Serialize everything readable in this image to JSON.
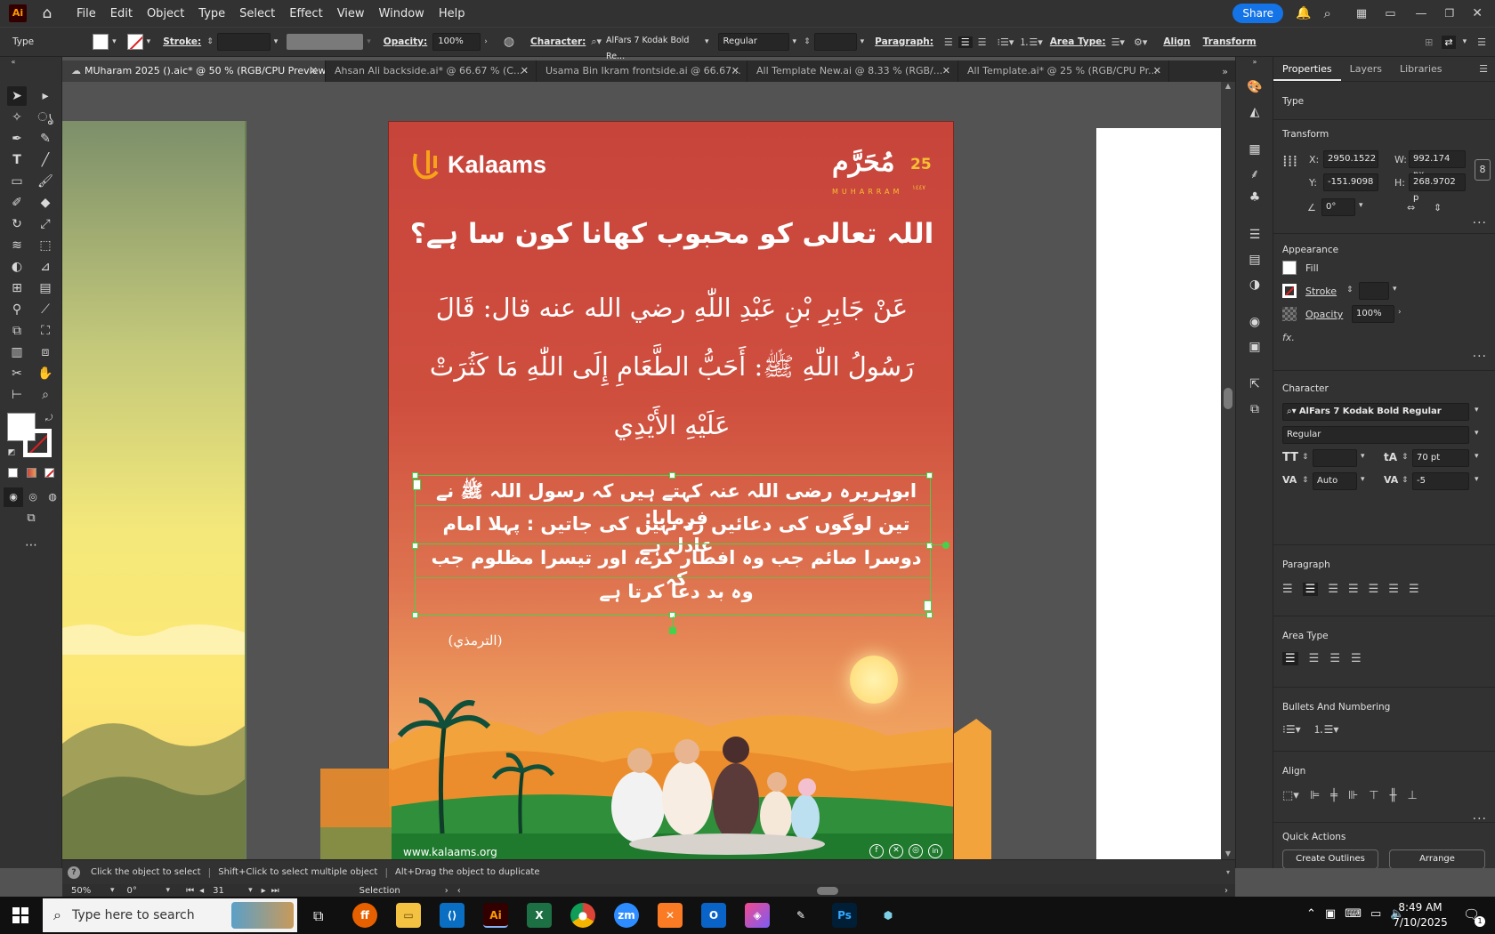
{
  "app": {
    "logo": "Ai",
    "share_label": "Share"
  },
  "menu": [
    "File",
    "Edit",
    "Object",
    "Type",
    "Select",
    "Effect",
    "View",
    "Window",
    "Help"
  ],
  "control": {
    "selection_type": "Type",
    "stroke_label": "Stroke:",
    "opacity_label": "Opacity:",
    "opacity_value": "100%",
    "character_label": "Character:",
    "font_name": "AlFars 7 Kodak Bold Re...",
    "font_style": "Regular",
    "paragraph_label": "Paragraph:",
    "area_type_label": "Area Type:",
    "align_label": "Align",
    "transform_label": "Transform"
  },
  "tabs": [
    {
      "label": "MUharam 2025 ().aic* @ 50 % (RGB/CPU Preview)"
    },
    {
      "label": "Ahsan Ali backside.ai* @ 66.67 % (C..."
    },
    {
      "label": "Usama Bin Ikram frontside.ai @ 66.67..."
    },
    {
      "label": "All Template New.ai @ 8.33 % (RGB/..."
    },
    {
      "label": "All Template.ai* @ 25 % (RGB/CPU Pr..."
    }
  ],
  "artboard": {
    "brand": "Kalaams",
    "muharram_arabic": "مُحَرَّم",
    "muharram_num": "25",
    "muharram_latin": "MUHARRAM",
    "muharram_year": "١٤٤٧",
    "heading": "اللہ تعالی کو محبوب کھانا کون سا ہے؟",
    "arabic_line1": "عَنْ جَابِرِ بْنِ عَبْدِ اللّٰهِ رضي الله عنه قال: قَالَ",
    "arabic_line2": "رَسُولُ اللّٰهِ ﷺ: أَحَبُّ الطَّعَامِ إِلَى اللّٰهِ مَا كَثُرَتْ",
    "arabic_line3": "عَلَيْهِ الأَيْدِي",
    "urdu_line1": "ابوہریرہ رضی اللہ عنہ کہتے ہیں کہ رسول اللہ ﷺ نے فرمایا:",
    "urdu_line2": "تین لوگوں کی دعائیں رد نہیں کی جاتیں : پہلا امام عادل ہے",
    "urdu_line3": "دوسرا صائم جب وہ افطار کرے، اور تیسرا مظلوم جب کہ",
    "urdu_line4": "وہ بد دعا کرتا ہے",
    "reference": "(الترمذي)",
    "website": "www.kalaams.org"
  },
  "panel": {
    "tabs": [
      "Properties",
      "Layers",
      "Libraries"
    ],
    "type_section": "Type",
    "transform_section": "Transform",
    "x_label": "X:",
    "x_value": "2950.1522",
    "y_label": "Y:",
    "y_value": "-151.9098",
    "w_label": "W:",
    "w_value": "992.174 px",
    "h_label": "H:",
    "h_value": "268.9702 p",
    "angle_value": "0°",
    "appearance_section": "Appearance",
    "fill_label": "Fill",
    "stroke_label": "Stroke",
    "opacity_label": "Opacity",
    "opacity_value": "100%",
    "fx_label": "fx.",
    "character_section": "Character",
    "font_name": "AlFars 7 Kodak Bold Regular",
    "font_style": "Regular",
    "leading_value": "70 pt",
    "kerning_value": "Auto",
    "tracking_value": "-5",
    "paragraph_section": "Paragraph",
    "area_type_section": "Area Type",
    "bullets_section": "Bullets And Numbering",
    "align_section": "Align",
    "quick_actions_section": "Quick Actions",
    "create_outlines_label": "Create Outlines",
    "arrange_label": "Arrange"
  },
  "status": {
    "hint1": "Click the object to select",
    "hint2": "Shift+Click to select multiple object",
    "hint3": "Alt+Drag the object to duplicate",
    "zoom": "50%",
    "rotation": "0°",
    "artboard_num": "31",
    "mode": "Selection"
  },
  "taskbar": {
    "search_placeholder": "Type here to search",
    "time": "8:49 AM",
    "date": "7/10/2025",
    "notifications": "1"
  },
  "colors": {
    "accent_blue": "#1473e6",
    "selection_green": "#46d14b",
    "ai_orange": "#ff9a00",
    "ai_bg": "#330000"
  }
}
